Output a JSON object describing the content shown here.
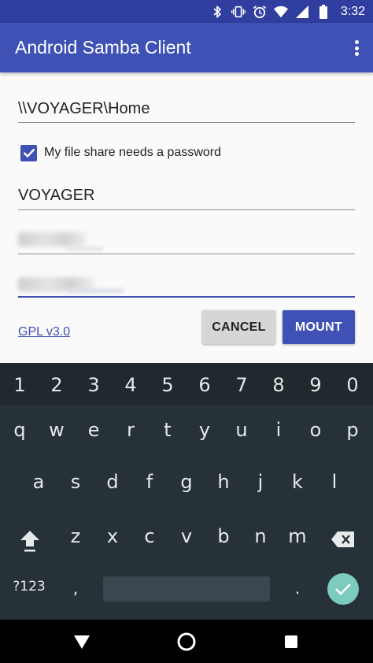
{
  "status_bar": {
    "time": "3:32",
    "icons": [
      "bluetooth-icon",
      "vibrate-icon",
      "alarm-icon",
      "wifi-icon",
      "signal-icon",
      "battery-icon"
    ]
  },
  "app_bar": {
    "title": "Android Samba Client",
    "overflow_icon": "more-vert-icon"
  },
  "form": {
    "share_path": "\\\\VOYAGER\\Home",
    "password_checkbox": {
      "label": "My file share needs a password",
      "checked": true
    },
    "domain": "VOYAGER",
    "username": "",
    "password": "",
    "license_link": "GPL v3.0",
    "cancel_label": "CANCEL",
    "mount_label": "MOUNT"
  },
  "keyboard": {
    "number_row": [
      "1",
      "2",
      "3",
      "4",
      "5",
      "6",
      "7",
      "8",
      "9",
      "0"
    ],
    "row1": [
      "q",
      "w",
      "e",
      "r",
      "t",
      "y",
      "u",
      "i",
      "o",
      "p"
    ],
    "row2": [
      "a",
      "s",
      "d",
      "f",
      "g",
      "h",
      "j",
      "k",
      "l"
    ],
    "row3": [
      "z",
      "x",
      "c",
      "v",
      "b",
      "n",
      "m"
    ],
    "symbols_label": "?123",
    "comma": ",",
    "period": "."
  },
  "colors": {
    "primary": "#3f51b5",
    "primary_dark": "#303f9f",
    "keyboard_bg": "#263238",
    "enter_key": "#7bcbbe"
  }
}
